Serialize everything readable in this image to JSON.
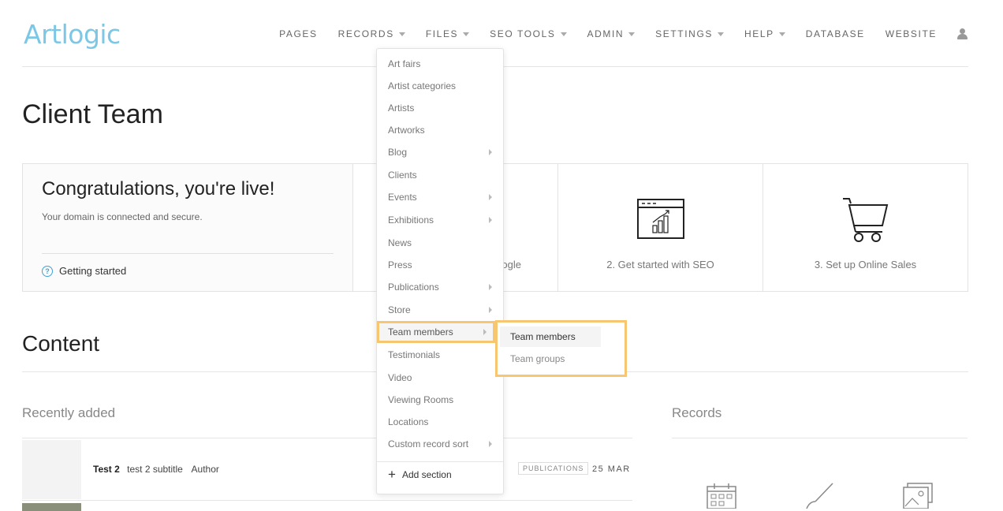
{
  "logo": "Artlogic",
  "nav": {
    "items": [
      {
        "label": "PAGES",
        "dropdown": false
      },
      {
        "label": "RECORDS",
        "dropdown": true
      },
      {
        "label": "FILES",
        "dropdown": true
      },
      {
        "label": "SEO TOOLS",
        "dropdown": true
      },
      {
        "label": "ADMIN",
        "dropdown": true
      },
      {
        "label": "SETTINGS",
        "dropdown": true
      },
      {
        "label": "HELP",
        "dropdown": true
      },
      {
        "label": "DATABASE",
        "dropdown": false
      },
      {
        "label": "WEBSITE",
        "dropdown": false
      }
    ]
  },
  "page_title": "Client Team",
  "welcome_card": {
    "heading": "Congratulations, you're live!",
    "subtitle": "Your domain is connected and secure.",
    "getting_started": "Getting started"
  },
  "cards": {
    "google": "ogle",
    "seo": "2. Get started with SEO",
    "sales": "3. Set up Online Sales"
  },
  "content_title": "Content",
  "recently_added_title": "Recently added",
  "records_title": "Records",
  "recent_rows": [
    {
      "title": "Test 2",
      "subtitle": "test 2 subtitle",
      "author": "Author",
      "badge": "PUBLICATIONS",
      "date": "25 MAR"
    }
  ],
  "records_dropdown": {
    "items": [
      {
        "label": "Art fairs",
        "submenu": false
      },
      {
        "label": "Artist categories",
        "submenu": false
      },
      {
        "label": "Artists",
        "submenu": false
      },
      {
        "label": "Artworks",
        "submenu": false
      },
      {
        "label": "Blog",
        "submenu": true
      },
      {
        "label": "Clients",
        "submenu": false
      },
      {
        "label": "Events",
        "submenu": true
      },
      {
        "label": "Exhibitions",
        "submenu": true
      },
      {
        "label": "News",
        "submenu": false
      },
      {
        "label": "Press",
        "submenu": false
      },
      {
        "label": "Publications",
        "submenu": true
      },
      {
        "label": "Store",
        "submenu": true
      },
      {
        "label": "Team members",
        "submenu": true
      },
      {
        "label": "Testimonials",
        "submenu": false
      },
      {
        "label": "Video",
        "submenu": false
      },
      {
        "label": "Viewing Rooms",
        "submenu": false
      },
      {
        "label": "Locations",
        "submenu": false
      },
      {
        "label": "Custom record sort",
        "submenu": true
      }
    ],
    "add_section": "Add section"
  },
  "team_submenu": {
    "items": [
      "Team members",
      "Team groups"
    ]
  },
  "colors": {
    "highlight": "#f6c670",
    "logo": "#7cc7e6",
    "help_icon": "#3ea2d8"
  }
}
